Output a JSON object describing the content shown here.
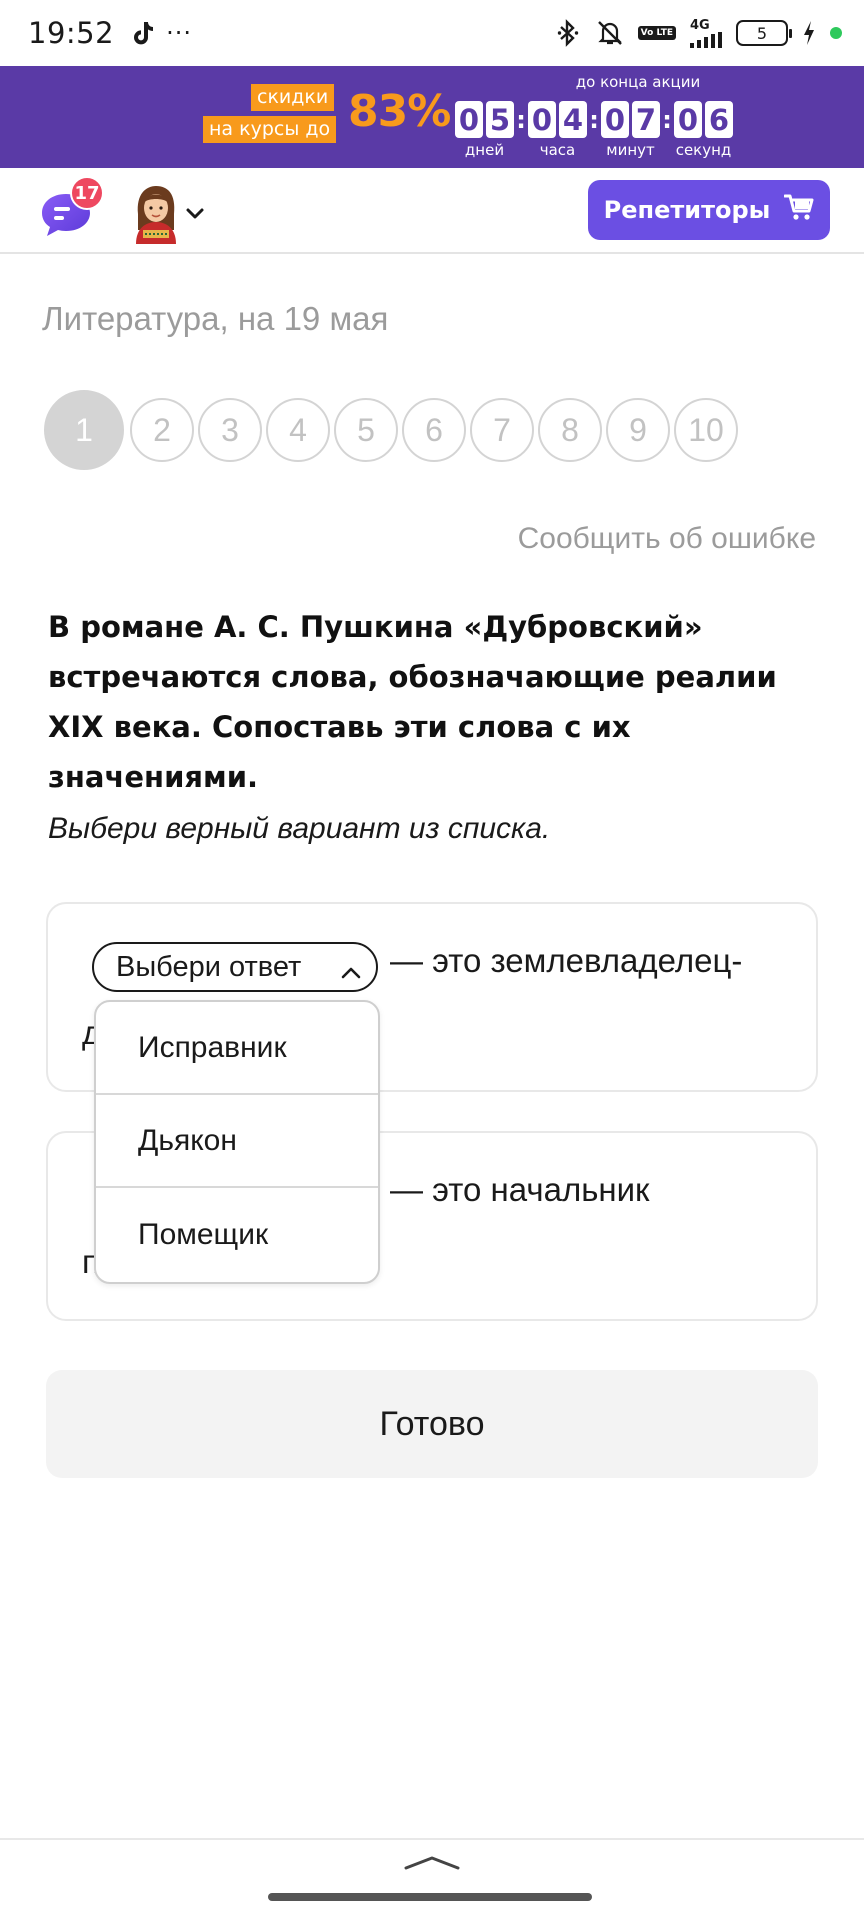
{
  "status_bar": {
    "time": "19:52",
    "dots": "···",
    "network": "4G",
    "volte": "Vo LTE",
    "battery": "5",
    "icons": [
      "tiktok-icon",
      "bluetooth-icon",
      "mute-icon",
      "volte-icon",
      "signal-icon",
      "battery-icon",
      "charging-icon"
    ]
  },
  "promo": {
    "tag_line1": "скидки",
    "tag_line2": "на курсы до",
    "percent": "83%",
    "until": "до конца акции",
    "days": [
      "0",
      "5"
    ],
    "hours": [
      "0",
      "4"
    ],
    "minutes": [
      "0",
      "7"
    ],
    "seconds": [
      "0",
      "6"
    ],
    "label_days": "дней",
    "label_hours": "часа",
    "label_minutes": "минут",
    "label_seconds": "секунд",
    "colors": {
      "background": "#5a3aa6",
      "accent": "#f89a1c"
    }
  },
  "header": {
    "chat_badge": "17",
    "tutors_button": "Репетиторы",
    "colors": {
      "button": "#6b4fe3",
      "badge": "#ee4860"
    }
  },
  "main": {
    "page_title": "Литература, на 19 мая",
    "steps": [
      "1",
      "2",
      "3",
      "4",
      "5",
      "6",
      "7",
      "8",
      "9",
      "10"
    ],
    "active_step": "1",
    "report_error": "Сообщить об ошибке",
    "question": "В романе А. С. Пушкина «Дубровский» встречаются слова, обозначающие реалии XIX века. Сопоставь эти слова с их значениями.",
    "hint": "Выбери верный вариант из списка.",
    "cards": [
      {
        "text": "— это землевладелец-",
        "cont": "д"
      },
      {
        "text": "— это начальник",
        "cont": "п"
      }
    ],
    "select_placeholder": "Выбери ответ",
    "dropdown_options": [
      "Исправник",
      "Дьякон",
      "Помещик"
    ],
    "done_button": "Готово"
  }
}
